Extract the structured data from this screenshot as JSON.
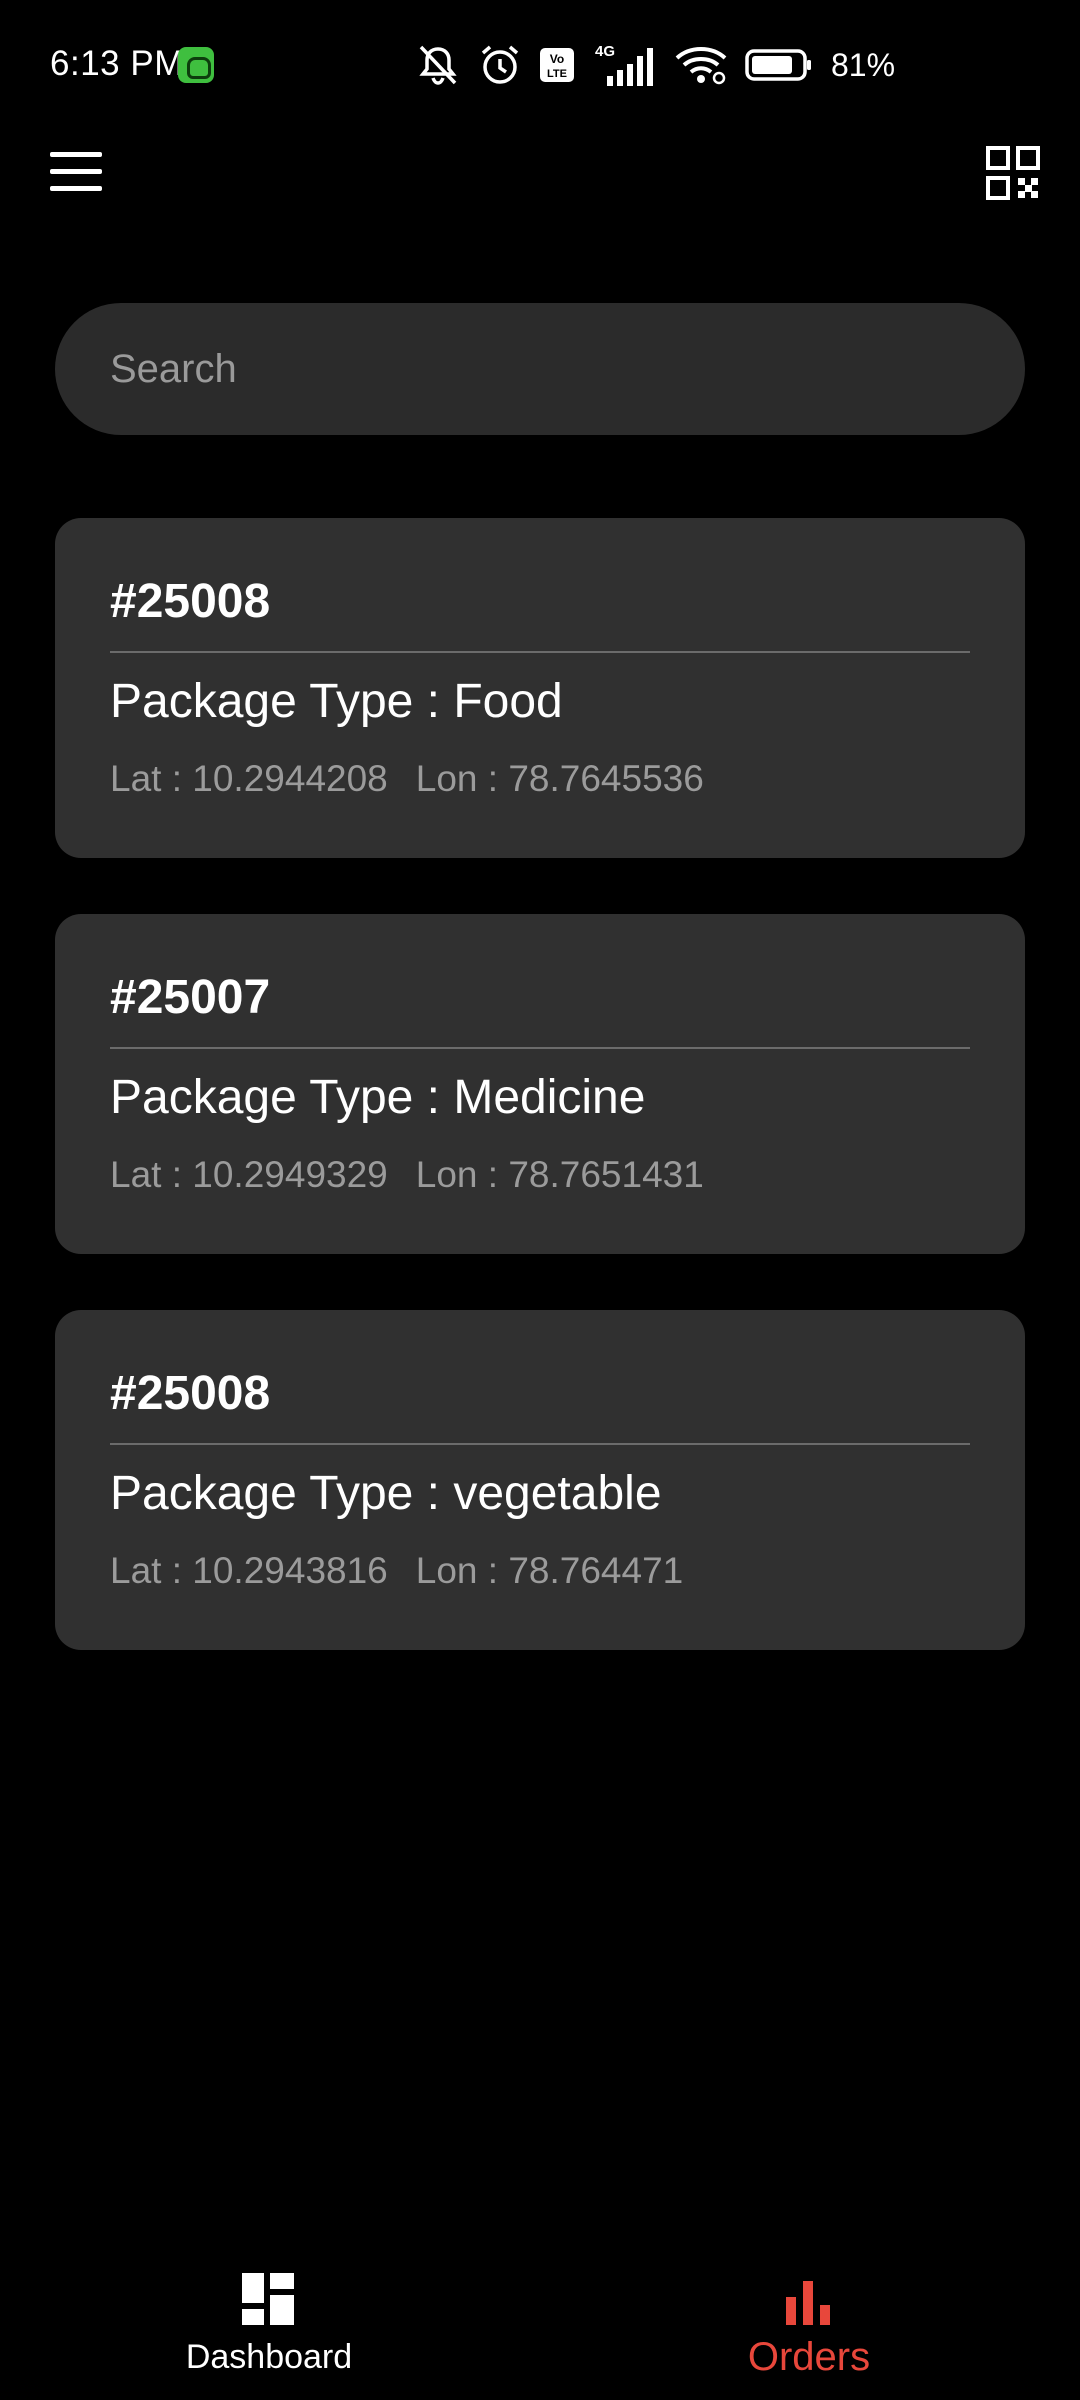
{
  "status_bar": {
    "time": "6:13 PM",
    "battery_percent": "81%",
    "icons": [
      "app-notification-icon",
      "mute-icon",
      "alarm-icon",
      "volte-icon",
      "signal-4g-icon",
      "wifi-icon",
      "battery-icon"
    ]
  },
  "app_bar": {
    "menu_icon": "hamburger-menu-icon",
    "qr_icon": "qr-code-icon"
  },
  "search": {
    "placeholder": "Search",
    "value": ""
  },
  "orders": [
    {
      "id": "#25008",
      "package_type": "Package Type : Food",
      "lat": "Lat : 10.2944208",
      "lon": "Lon : 78.7645536"
    },
    {
      "id": "#25007",
      "package_type": "Package Type : Medicine",
      "lat": "Lat : 10.2949329",
      "lon": "Lon : 78.7651431"
    },
    {
      "id": "#25008",
      "package_type": "Package Type : vegetable",
      "lat": "Lat : 10.2943816",
      "lon": "Lon : 78.764471"
    }
  ],
  "bottom_nav": {
    "items": [
      {
        "label": "Dashboard",
        "icon": "dashboard-icon",
        "active": false
      },
      {
        "label": "Orders",
        "icon": "bar-chart-icon",
        "active": true
      }
    ],
    "active_color": "#e8473b"
  },
  "colors": {
    "background": "#000000",
    "card": "#303030",
    "search_field": "#2b2b2b",
    "accent": "#e8473b"
  }
}
